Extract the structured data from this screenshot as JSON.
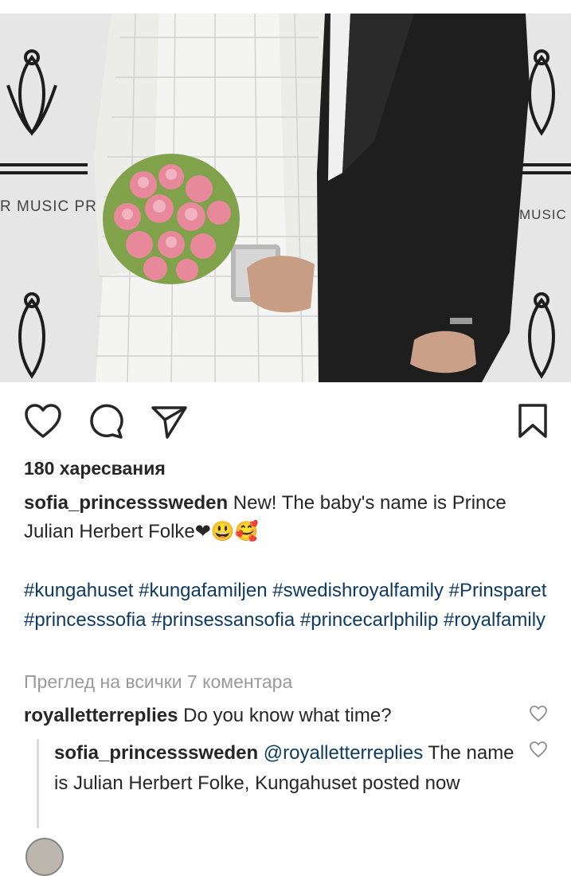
{
  "post": {
    "likes": "180 харесвания",
    "username": "sofia_princesssweden",
    "caption_text": " New! The baby's name is Prince Julian Herbert Folke",
    "caption_emojis": "❤😃🥰",
    "hashtags": [
      "#kungahuset",
      "#kungafamiljen",
      "#swedishroyalfamily",
      "#Prinsparet",
      "#princesssofia",
      "#prinsessansofia",
      "#princecarlphilip",
      "#royalfamily"
    ],
    "view_all_comments": "Преглед на всички 7 коментара"
  },
  "photo": {
    "backdrop_text_left": "R MUSIC PR",
    "backdrop_text_right": "MUSIC"
  },
  "comments": [
    {
      "username": "royalletterreplies",
      "text": " Do you know what time?"
    }
  ],
  "reply": {
    "username": "sofia_princesssweden",
    "mention": "@royalletterreplies",
    "text": " The name is Julian Herbert Folke, Kungahuset posted now"
  },
  "icons": {
    "like": "heart-outline-icon",
    "comment": "comment-bubble-icon",
    "share": "paper-plane-icon",
    "save": "bookmark-icon"
  }
}
